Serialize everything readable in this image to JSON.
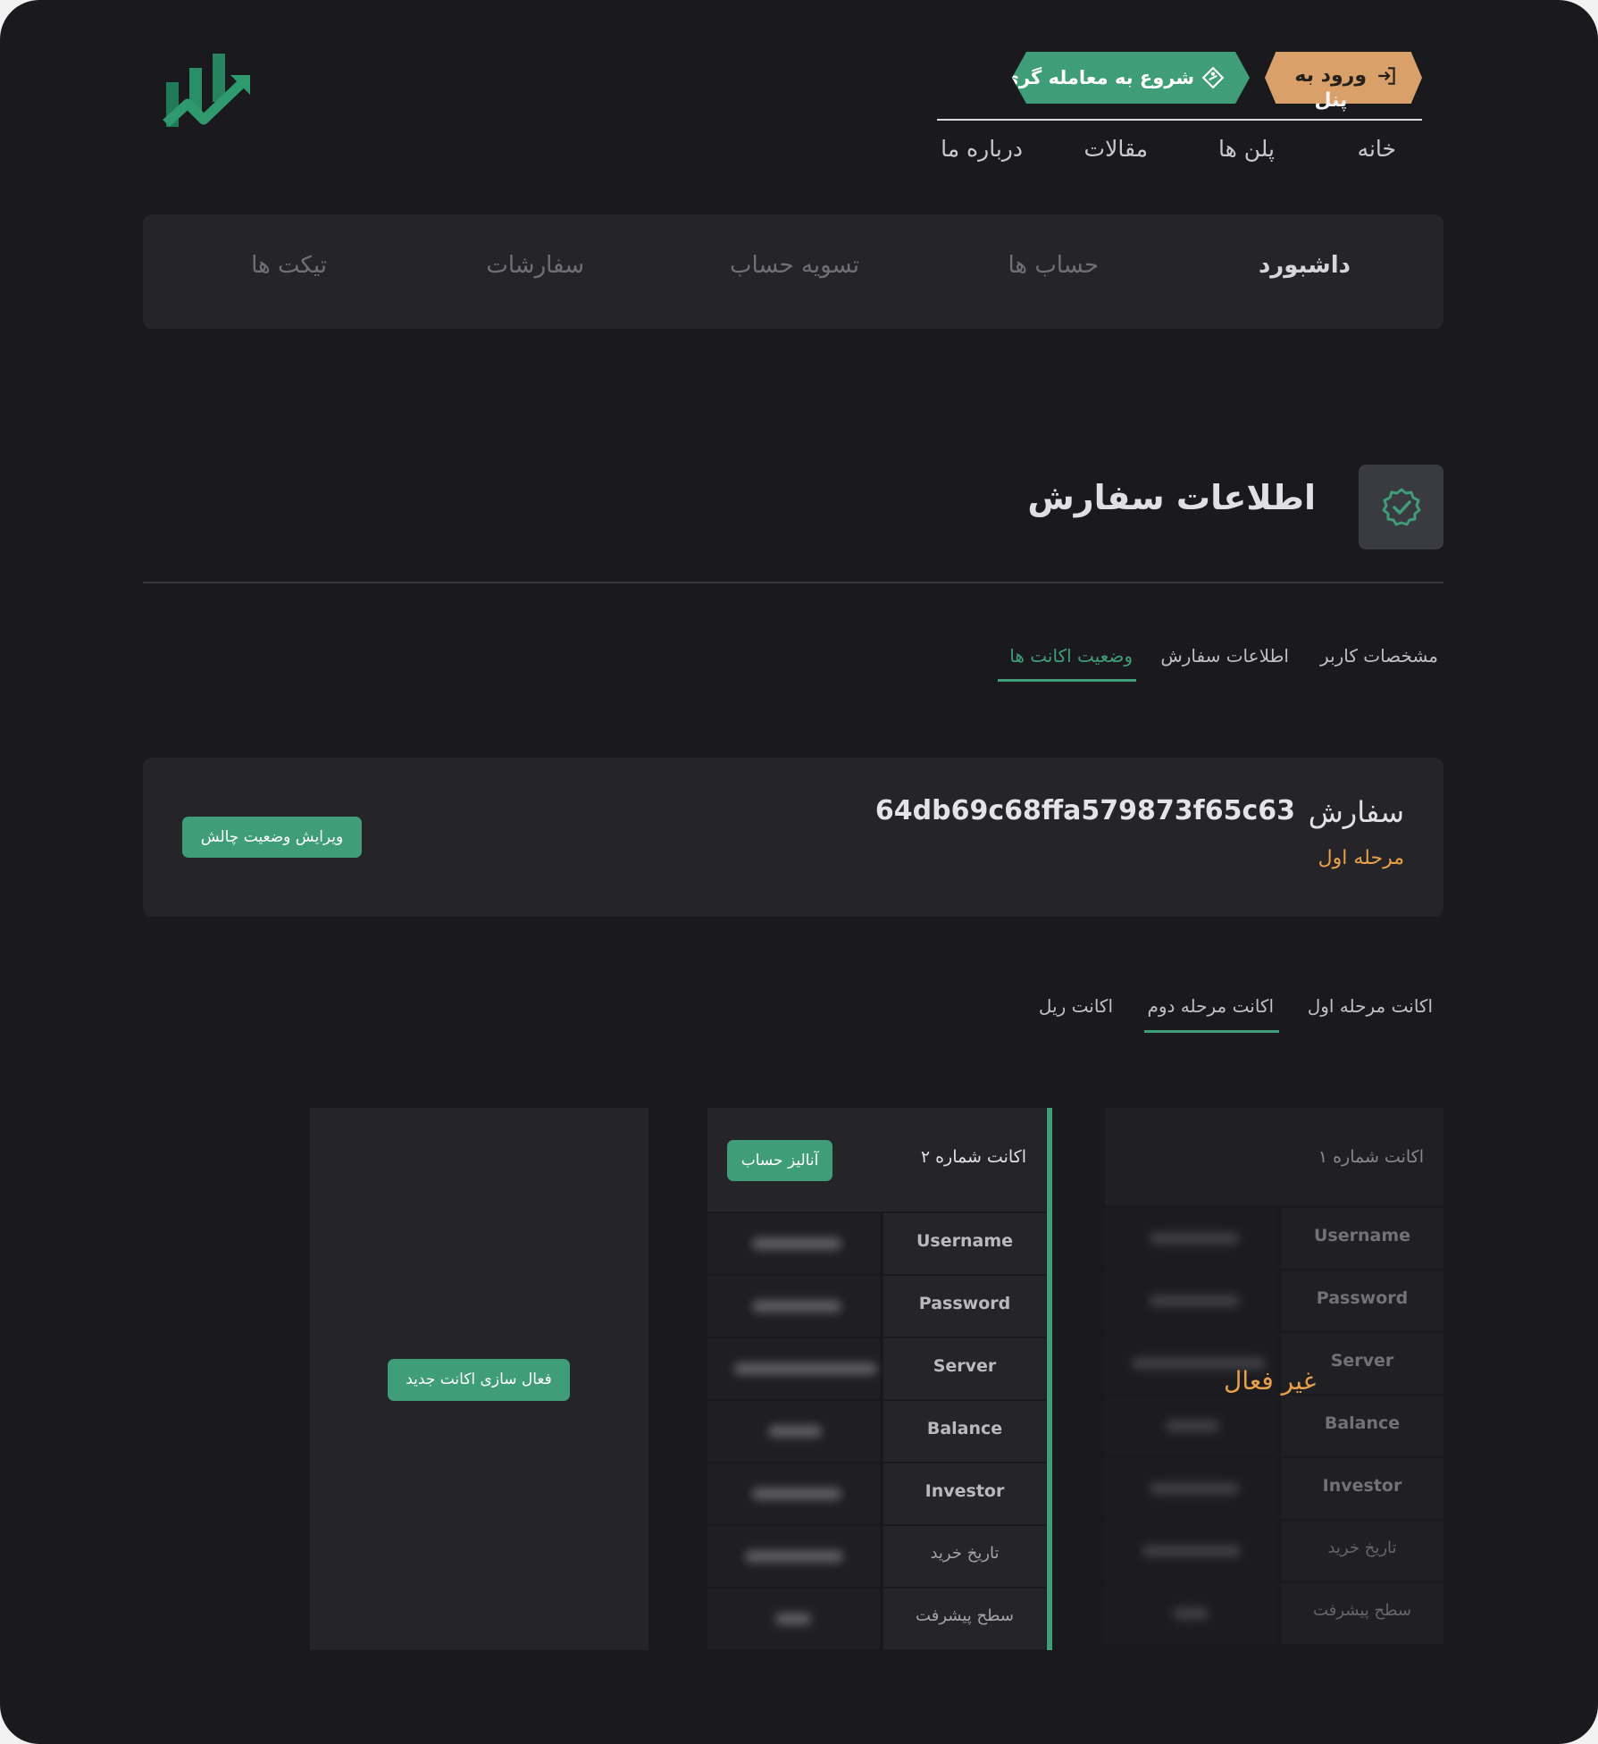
{
  "header": {
    "login_button": "ورود به",
    "login_button_sub": "پنل",
    "trade_button": "شروع به معامله گری",
    "nav": [
      "خانه",
      "پلن ها",
      "مقالات",
      "درباره ما"
    ]
  },
  "dashboard_tabs": [
    "داشبورد",
    "حساب ها",
    "تسویه حساب",
    "سفارشات",
    "تیکت ها"
  ],
  "page_title": "اطلاعات سفارش",
  "section_tabs": {
    "items": [
      "مشخصات کاربر",
      "اطلاعات سفارش",
      "وضعیت اکانت ها"
    ],
    "active_index": 2
  },
  "order": {
    "label": "سفارش",
    "id": "64db69c68ffa579873f65c63",
    "stage": "مرحله اول",
    "edit_button": "ویرایش وضعیت چالش"
  },
  "account_tabs": {
    "items": [
      "اکانت مرحله اول",
      "اکانت مرحله دوم",
      "اکانت ریل"
    ],
    "active_index": 1
  },
  "accounts": {
    "account1": {
      "title": "اکانت شماره ۱",
      "status_overlay": "غیر فعال",
      "rows": [
        "Username",
        "Password",
        "Server",
        "Balance",
        "Investor",
        "تاریخ خرید",
        "سطح پیشرفت"
      ]
    },
    "account2": {
      "title": "اکانت شماره ۲",
      "analyze_button": "آنالیز حساب",
      "rows": [
        "Username",
        "Password",
        "Server",
        "Balance",
        "Investor",
        "تاریخ خرید",
        "سطح پیشرفت"
      ]
    },
    "new_account_button": "فعال سازی اکانت جدید"
  },
  "colors": {
    "accent_green": "#3f9d77",
    "accent_orange": "#d9a06a",
    "stage_orange": "#e8a04a",
    "background": "#1a1a1e",
    "panel": "#252529"
  }
}
